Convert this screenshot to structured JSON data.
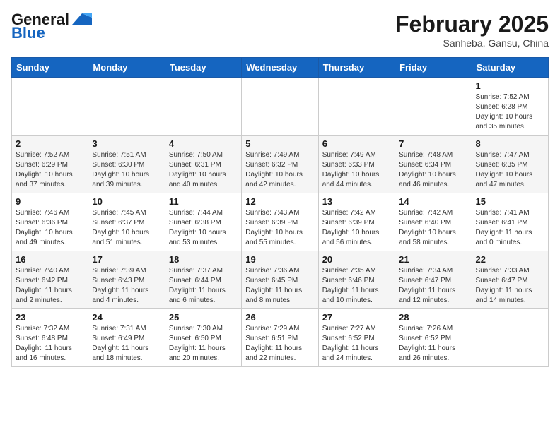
{
  "header": {
    "logo_general": "General",
    "logo_blue": "Blue",
    "month_year": "February 2025",
    "location": "Sanheba, Gansu, China"
  },
  "weekdays": [
    "Sunday",
    "Monday",
    "Tuesday",
    "Wednesday",
    "Thursday",
    "Friday",
    "Saturday"
  ],
  "weeks": [
    [
      {
        "day": "",
        "info": ""
      },
      {
        "day": "",
        "info": ""
      },
      {
        "day": "",
        "info": ""
      },
      {
        "day": "",
        "info": ""
      },
      {
        "day": "",
        "info": ""
      },
      {
        "day": "",
        "info": ""
      },
      {
        "day": "1",
        "info": "Sunrise: 7:52 AM\nSunset: 6:28 PM\nDaylight: 10 hours\nand 35 minutes."
      }
    ],
    [
      {
        "day": "2",
        "info": "Sunrise: 7:52 AM\nSunset: 6:29 PM\nDaylight: 10 hours\nand 37 minutes."
      },
      {
        "day": "3",
        "info": "Sunrise: 7:51 AM\nSunset: 6:30 PM\nDaylight: 10 hours\nand 39 minutes."
      },
      {
        "day": "4",
        "info": "Sunrise: 7:50 AM\nSunset: 6:31 PM\nDaylight: 10 hours\nand 40 minutes."
      },
      {
        "day": "5",
        "info": "Sunrise: 7:49 AM\nSunset: 6:32 PM\nDaylight: 10 hours\nand 42 minutes."
      },
      {
        "day": "6",
        "info": "Sunrise: 7:49 AM\nSunset: 6:33 PM\nDaylight: 10 hours\nand 44 minutes."
      },
      {
        "day": "7",
        "info": "Sunrise: 7:48 AM\nSunset: 6:34 PM\nDaylight: 10 hours\nand 46 minutes."
      },
      {
        "day": "8",
        "info": "Sunrise: 7:47 AM\nSunset: 6:35 PM\nDaylight: 10 hours\nand 47 minutes."
      }
    ],
    [
      {
        "day": "9",
        "info": "Sunrise: 7:46 AM\nSunset: 6:36 PM\nDaylight: 10 hours\nand 49 minutes."
      },
      {
        "day": "10",
        "info": "Sunrise: 7:45 AM\nSunset: 6:37 PM\nDaylight: 10 hours\nand 51 minutes."
      },
      {
        "day": "11",
        "info": "Sunrise: 7:44 AM\nSunset: 6:38 PM\nDaylight: 10 hours\nand 53 minutes."
      },
      {
        "day": "12",
        "info": "Sunrise: 7:43 AM\nSunset: 6:39 PM\nDaylight: 10 hours\nand 55 minutes."
      },
      {
        "day": "13",
        "info": "Sunrise: 7:42 AM\nSunset: 6:39 PM\nDaylight: 10 hours\nand 56 minutes."
      },
      {
        "day": "14",
        "info": "Sunrise: 7:42 AM\nSunset: 6:40 PM\nDaylight: 10 hours\nand 58 minutes."
      },
      {
        "day": "15",
        "info": "Sunrise: 7:41 AM\nSunset: 6:41 PM\nDaylight: 11 hours\nand 0 minutes."
      }
    ],
    [
      {
        "day": "16",
        "info": "Sunrise: 7:40 AM\nSunset: 6:42 PM\nDaylight: 11 hours\nand 2 minutes."
      },
      {
        "day": "17",
        "info": "Sunrise: 7:39 AM\nSunset: 6:43 PM\nDaylight: 11 hours\nand 4 minutes."
      },
      {
        "day": "18",
        "info": "Sunrise: 7:37 AM\nSunset: 6:44 PM\nDaylight: 11 hours\nand 6 minutes."
      },
      {
        "day": "19",
        "info": "Sunrise: 7:36 AM\nSunset: 6:45 PM\nDaylight: 11 hours\nand 8 minutes."
      },
      {
        "day": "20",
        "info": "Sunrise: 7:35 AM\nSunset: 6:46 PM\nDaylight: 11 hours\nand 10 minutes."
      },
      {
        "day": "21",
        "info": "Sunrise: 7:34 AM\nSunset: 6:47 PM\nDaylight: 11 hours\nand 12 minutes."
      },
      {
        "day": "22",
        "info": "Sunrise: 7:33 AM\nSunset: 6:47 PM\nDaylight: 11 hours\nand 14 minutes."
      }
    ],
    [
      {
        "day": "23",
        "info": "Sunrise: 7:32 AM\nSunset: 6:48 PM\nDaylight: 11 hours\nand 16 minutes."
      },
      {
        "day": "24",
        "info": "Sunrise: 7:31 AM\nSunset: 6:49 PM\nDaylight: 11 hours\nand 18 minutes."
      },
      {
        "day": "25",
        "info": "Sunrise: 7:30 AM\nSunset: 6:50 PM\nDaylight: 11 hours\nand 20 minutes."
      },
      {
        "day": "26",
        "info": "Sunrise: 7:29 AM\nSunset: 6:51 PM\nDaylight: 11 hours\nand 22 minutes."
      },
      {
        "day": "27",
        "info": "Sunrise: 7:27 AM\nSunset: 6:52 PM\nDaylight: 11 hours\nand 24 minutes."
      },
      {
        "day": "28",
        "info": "Sunrise: 7:26 AM\nSunset: 6:52 PM\nDaylight: 11 hours\nand 26 minutes."
      },
      {
        "day": "",
        "info": ""
      }
    ]
  ]
}
